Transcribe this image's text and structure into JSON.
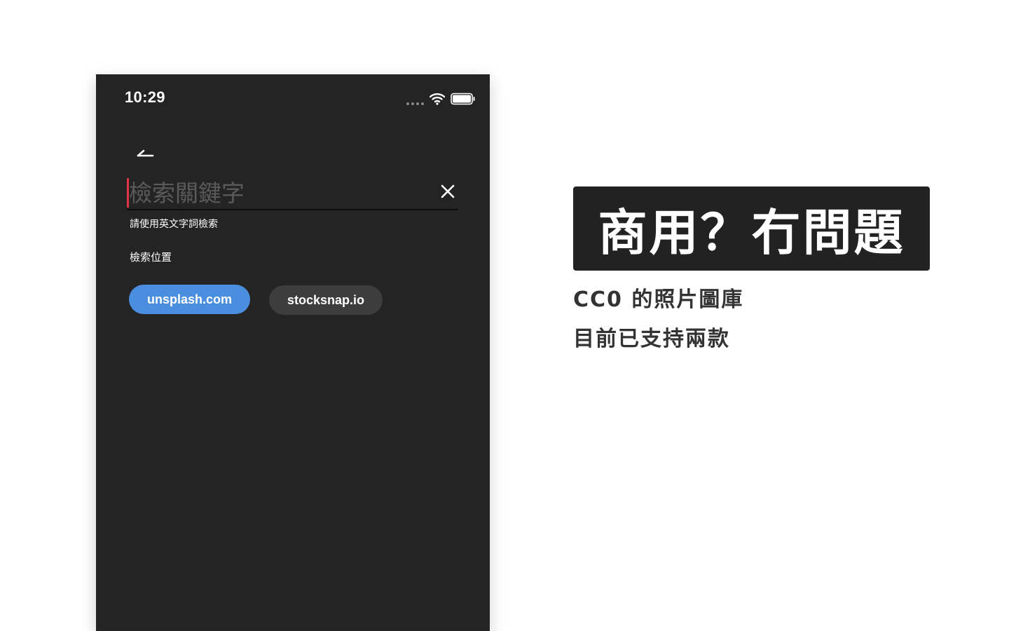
{
  "phone": {
    "status_bar": {
      "time": "10:29",
      "icons": [
        "signal-dots-icon",
        "wifi-icon",
        "battery-icon"
      ]
    },
    "back_icon": "back-arrow-icon",
    "search": {
      "placeholder": "檢索關鍵字",
      "value": "",
      "clear_icon": "close-icon"
    },
    "helper_text": "請使用英文字詞檢索",
    "section_label": "檢索位置",
    "sources": [
      {
        "label": "unsplash.com",
        "selected": true
      },
      {
        "label": "stocksnap.io",
        "selected": false
      }
    ]
  },
  "promo": {
    "headline": "商用？冇問題",
    "lines": [
      "CC0 的照片圖庫",
      "目前已支持兩款"
    ]
  },
  "colors": {
    "phone_background": "#242424",
    "accent_selected": "#4a8edf",
    "chip_unselected": "#3d3d3d",
    "cursor": "#e0344a",
    "headline_box": "#222222",
    "promo_text": "#333333"
  }
}
